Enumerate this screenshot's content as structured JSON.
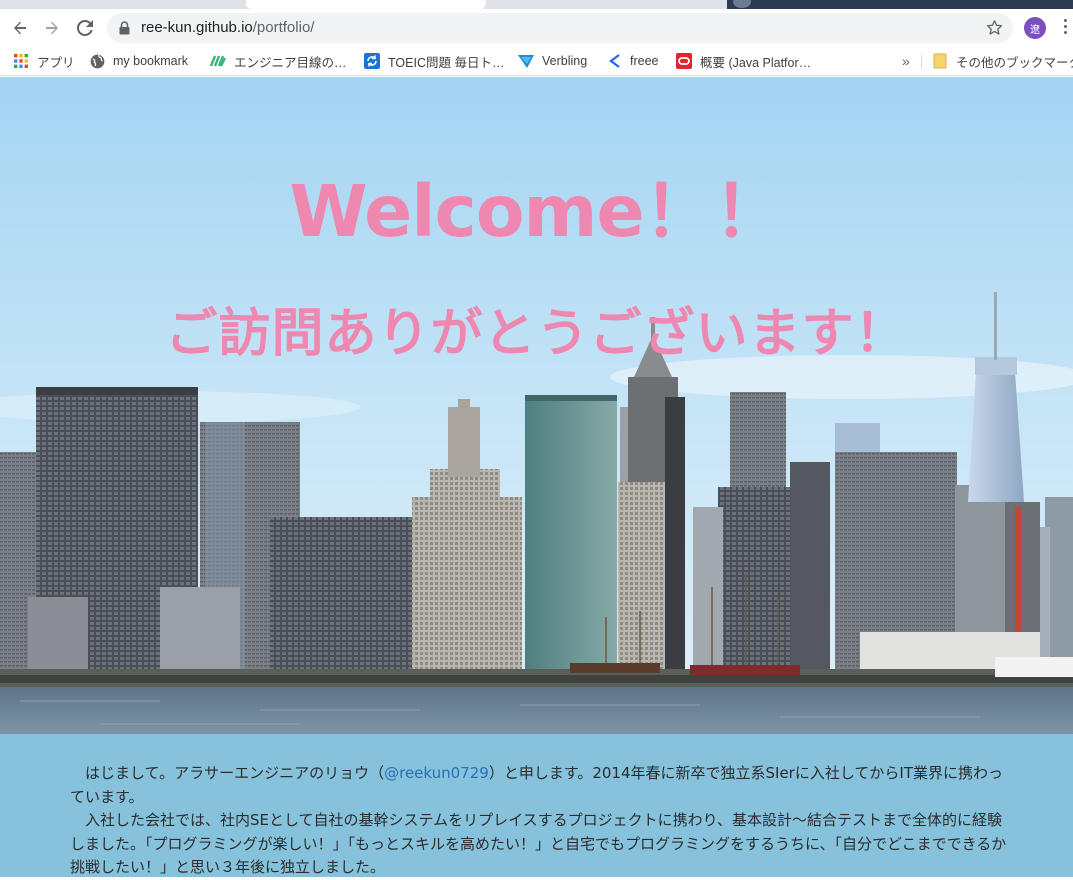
{
  "browser": {
    "url_host": "ree-kun.github.io",
    "url_path": "/portfolio/",
    "avatar_letter": "遼"
  },
  "bookmarks": [
    {
      "label": "アプリ",
      "icon": "apps-grid-icon"
    },
    {
      "label": "my bookmark",
      "icon": "globe-icon"
    },
    {
      "label": "エンジニア目線の…",
      "icon": "green-stripes-icon"
    },
    {
      "label": "TOEIC問題 毎日ト…",
      "icon": "blue-refresh-icon"
    },
    {
      "label": "Verbling",
      "icon": "verbling-icon"
    },
    {
      "label": "freee",
      "icon": "freee-icon"
    },
    {
      "label": "概要 (Java Platfor…",
      "icon": "oracle-icon"
    }
  ],
  "bookmarks_overflow": "»",
  "other_bookmarks": "その他のブックマーク",
  "hero": {
    "title": "Welcome！！",
    "subtitle": "ご訪問ありがとうございます！"
  },
  "intro": {
    "p1_before": "はじまして。アラサーエンジニアのリョウ（",
    "p1_handle": "@reekun0729",
    "p1_after": "）と申します。2014年春に新卒で独立系SIerに入社してからIT業界に携わっています。",
    "p2": "入社した会社では、社内SEとして自社の基幹システムをリプレイスするプロジェクトに携わり、基本設計〜結合テストまで全体的に経験しました。「プログラミングが楽しい！」「もっとスキルを高めたい！」と自宅でもプログラミングをするうちに、「自分でどこまでできるか挑戦したい！」と思い３年後に独立しました。"
  }
}
